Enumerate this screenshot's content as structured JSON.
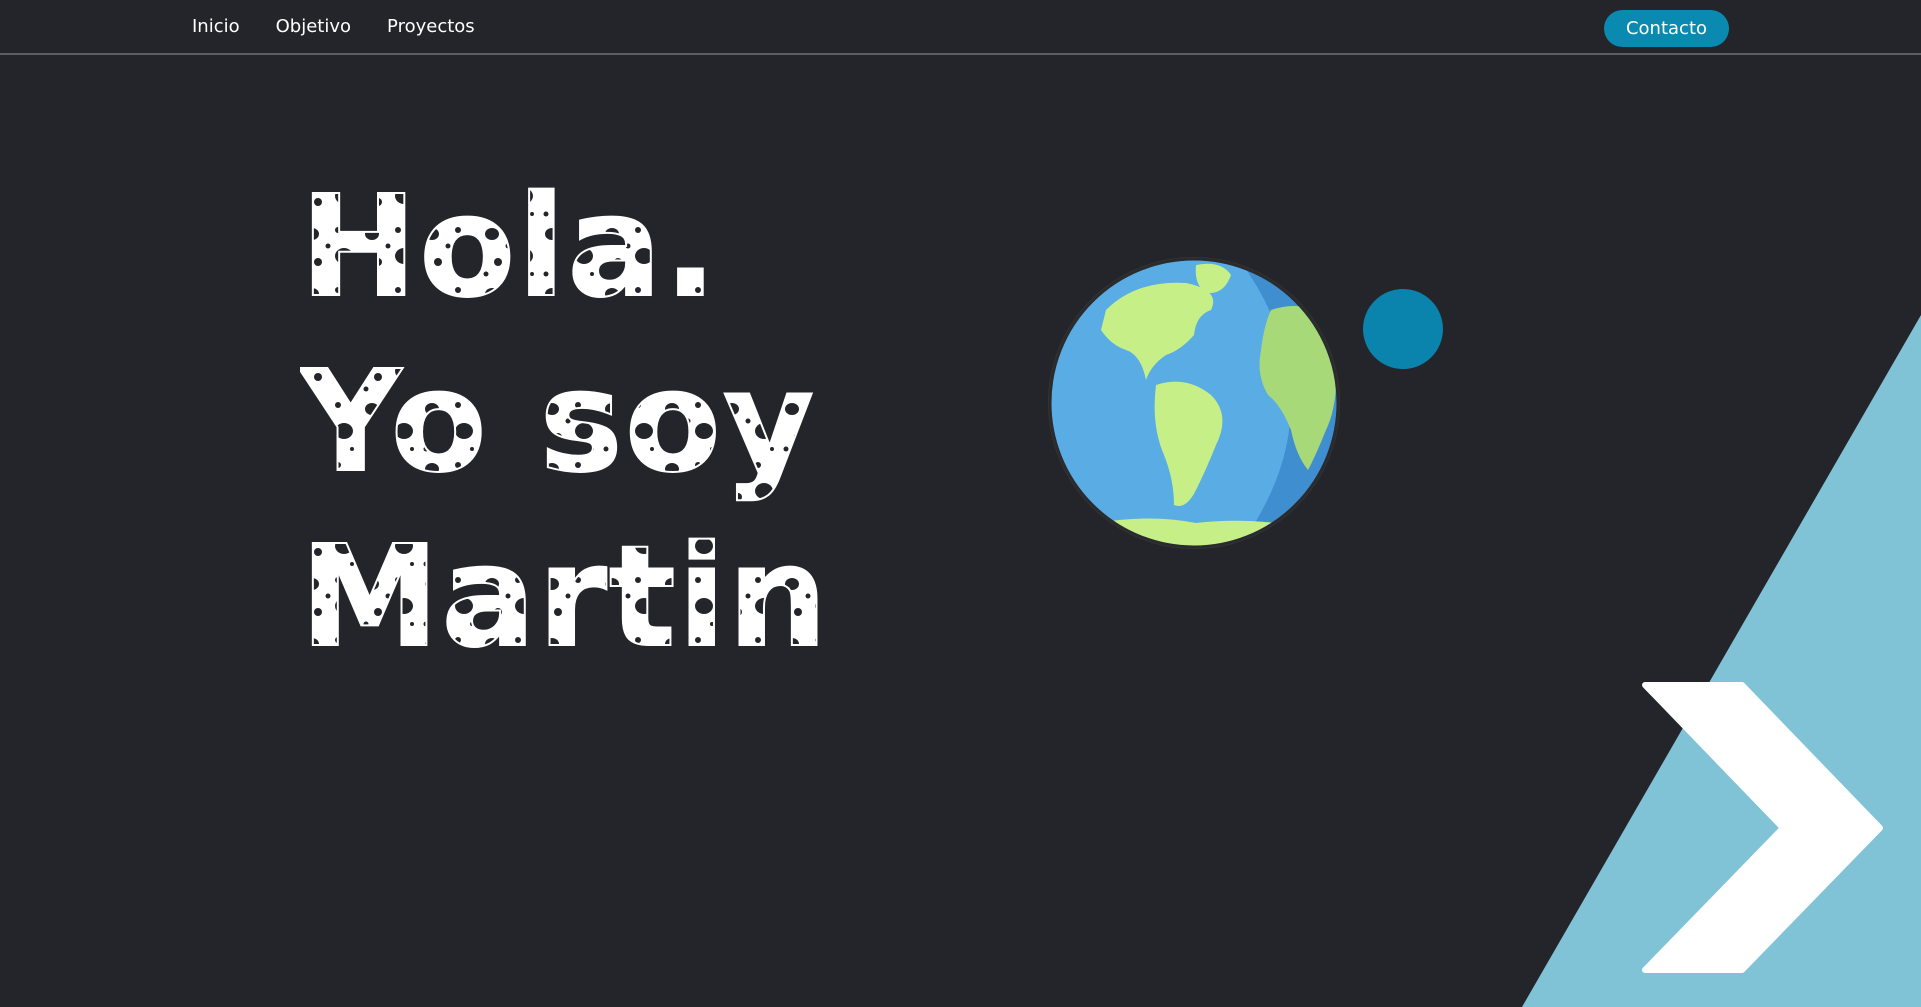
{
  "nav": {
    "links": [
      "Inicio",
      "Objetivo",
      "Proyectos"
    ],
    "contact_label": "Contacto"
  },
  "hero": {
    "lines": [
      "Hola.",
      "Yo soy",
      "Martin"
    ]
  },
  "colors": {
    "background": "#24252a",
    "accent": "#0a8ab1",
    "moon": "#0a84ac",
    "triangle": "#80c3d6",
    "globe_ocean": "#5aace4",
    "globe_land": "#c7ef87",
    "text": "#ffffff"
  },
  "icons": {
    "planet": "earth-globe-icon",
    "moon": "moon-icon",
    "arrow": "chevron-right-icon"
  }
}
